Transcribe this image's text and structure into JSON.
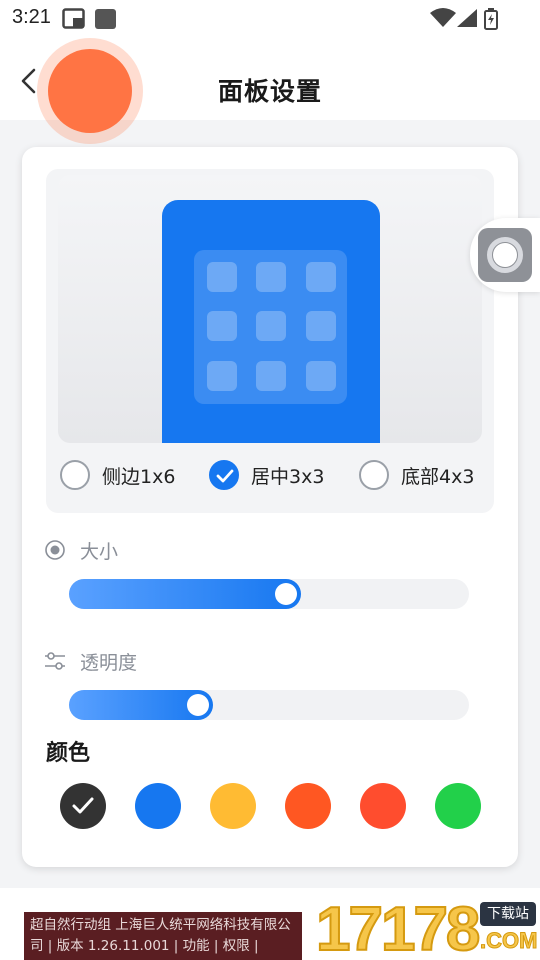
{
  "status_bar": {
    "time": "3:21",
    "icons": [
      "screenshot-icon",
      "app-icon",
      "wifi-icon",
      "signal-icon",
      "battery-icon"
    ]
  },
  "header": {
    "title": "面板设置",
    "back_icon": "chevron-left-icon"
  },
  "layout_options": [
    {
      "label": "侧边1x6",
      "selected": false
    },
    {
      "label": "居中3x3",
      "selected": true
    },
    {
      "label": "底部4x3",
      "selected": false
    }
  ],
  "size_setting": {
    "label": "大小",
    "icon": "radio-dot-icon",
    "value_fraction": 0.58
  },
  "opacity_setting": {
    "label": "透明度",
    "icon": "sliders-icon",
    "value_fraction": 0.36
  },
  "colors": {
    "title": "颜色",
    "swatches": [
      {
        "hex": "#333333",
        "selected": true
      },
      {
        "hex": "#1677f0",
        "selected": false
      },
      {
        "hex": "#ffbb33",
        "selected": false
      },
      {
        "hex": "#ff5722",
        "selected": false
      },
      {
        "hex": "#ff4d2e",
        "selected": false
      },
      {
        "hex": "#22d04a",
        "selected": false
      }
    ]
  },
  "accent_color": "#1677f0",
  "bottom_ad": {
    "text": "超自然行动组 上海巨人统平网络科技有限公司 | 版本 1.26.11.001 | 功能 | 权限 |"
  },
  "watermark": {
    "number": "17178",
    "tag": "下载站",
    "suffix": ".COM"
  }
}
